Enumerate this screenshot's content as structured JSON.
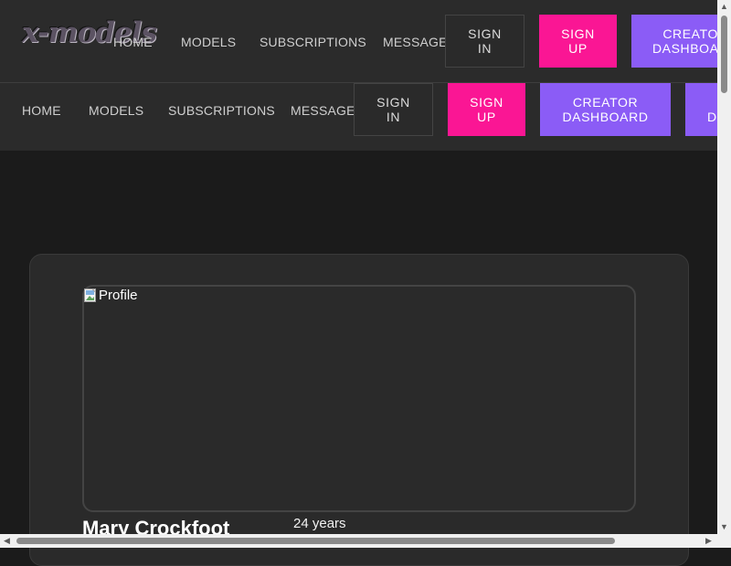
{
  "brand": {
    "logo_text": "x-models"
  },
  "nav_primary": {
    "links": [
      "HOME",
      "MODELS",
      "SUBSCRIPTIONS",
      "MESSAGES"
    ],
    "sign_in": "SIGN IN",
    "sign_up": "SIGN UP",
    "creator_dashboard": "CREATOR DASHBOARD"
  },
  "nav_secondary": {
    "links": [
      "HOME",
      "MODELS",
      "SUBSCRIPTIONS",
      "MESSAGES"
    ],
    "sign_in": "SIGN IN",
    "sign_up": "SIGN UP",
    "creator_dashboard": "CREATOR DASHBOARD",
    "dashboard_partial": "D"
  },
  "profile": {
    "image_alt": "Profile",
    "name": "Mary Crockfoot",
    "age": "24 years"
  },
  "colors": {
    "accent_pink": "#fa1694",
    "accent_purple": "#8b5cf6",
    "page_bg": "#1b1b1b",
    "header_bg": "#2b2b2b"
  },
  "icons": {
    "broken_image": "broken-image-icon",
    "scroll_up": "up-arrow-icon",
    "scroll_down": "down-arrow-icon",
    "scroll_left": "left-arrow-icon",
    "scroll_right": "right-arrow-icon"
  }
}
